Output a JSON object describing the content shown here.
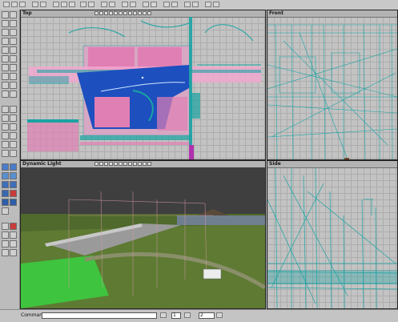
{
  "viewports": {
    "top": {
      "title": "Top"
    },
    "front": {
      "title": "Front"
    },
    "dynamic": {
      "title": "Dynamic Light"
    },
    "side": {
      "title": "Side"
    }
  },
  "command": {
    "label": "Command:",
    "value": "",
    "layer_value": "1",
    "num_value": "2"
  },
  "colors": {
    "wire": "#1aa3a3",
    "pink": "#e07fb4",
    "blue": "#1d4fbf",
    "grass": "#6a8a3a",
    "sky": "#4a4a4a"
  }
}
